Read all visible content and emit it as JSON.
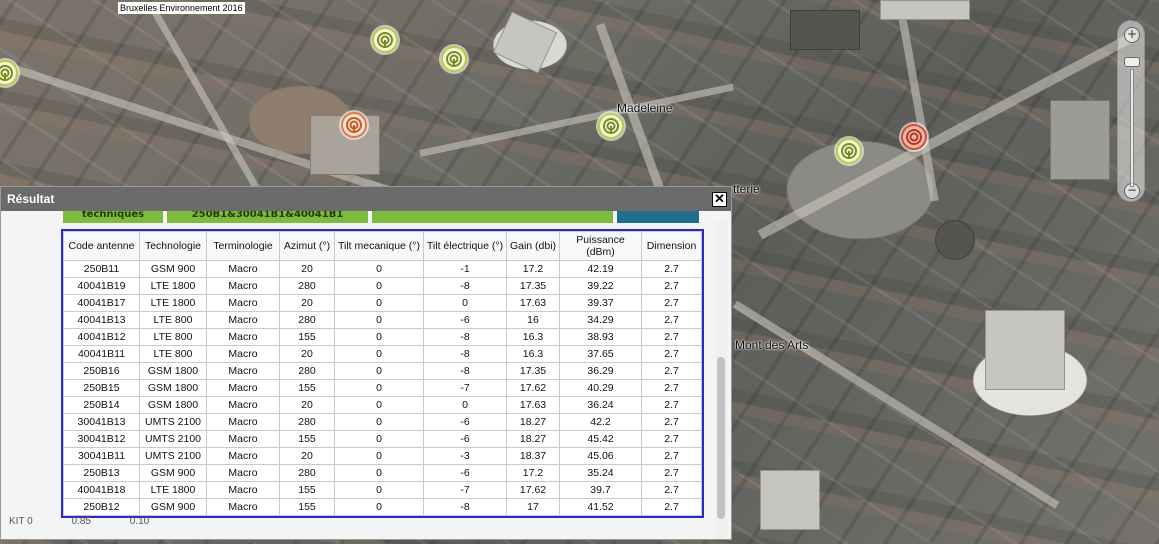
{
  "map": {
    "copyright": "Bruxelles Environnement 2016",
    "labels": {
      "madeleine": "Madeleine",
      "etterie": "tterie",
      "mont_des_arts": "Mont des Arts"
    },
    "zoom": {
      "in_label": "+",
      "out_label": "−"
    }
  },
  "panel": {
    "title": "Résultat",
    "close_label": "✕",
    "tabs": [
      "techniques",
      "250B1&30041B1&40041B1",
      "",
      ""
    ],
    "table": {
      "headers": [
        "Code antenne",
        "Technologie",
        "Terminologie",
        "Azimut (°)",
        "Tilt mecanique (°)",
        "Tilt électrique (°)",
        "Gain (dbi)",
        "Puissance (dBm)",
        "Dimension"
      ],
      "rows": [
        [
          "250B11",
          "GSM 900",
          "Macro",
          "20",
          "0",
          "-1",
          "17.2",
          "42.19",
          "2.7"
        ],
        [
          "40041B19",
          "LTE 1800",
          "Macro",
          "280",
          "0",
          "-8",
          "17.35",
          "39.22",
          "2.7"
        ],
        [
          "40041B17",
          "LTE 1800",
          "Macro",
          "20",
          "0",
          "0",
          "17.63",
          "39.37",
          "2.7"
        ],
        [
          "40041B13",
          "LTE 800",
          "Macro",
          "280",
          "0",
          "-6",
          "16",
          "34.29",
          "2.7"
        ],
        [
          "40041B12",
          "LTE 800",
          "Macro",
          "155",
          "0",
          "-8",
          "16.3",
          "38.93",
          "2.7"
        ],
        [
          "40041B11",
          "LTE 800",
          "Macro",
          "20",
          "0",
          "-8",
          "16.3",
          "37.65",
          "2.7"
        ],
        [
          "250B16",
          "GSM 1800",
          "Macro",
          "280",
          "0",
          "-8",
          "17.35",
          "36.29",
          "2.7"
        ],
        [
          "250B15",
          "GSM 1800",
          "Macro",
          "155",
          "0",
          "-7",
          "17.62",
          "40.29",
          "2.7"
        ],
        [
          "250B14",
          "GSM 1800",
          "Macro",
          "20",
          "0",
          "0",
          "17.63",
          "36.24",
          "2.7"
        ],
        [
          "30041B13",
          "UMTS 2100",
          "Macro",
          "280",
          "0",
          "-6",
          "18.27",
          "42.2",
          "2.7"
        ],
        [
          "30041B12",
          "UMTS 2100",
          "Macro",
          "155",
          "0",
          "-6",
          "18.27",
          "45.42",
          "2.7"
        ],
        [
          "30041B11",
          "UMTS 2100",
          "Macro",
          "20",
          "0",
          "-3",
          "18.37",
          "45.06",
          "2.7"
        ],
        [
          "250B13",
          "GSM 900",
          "Macro",
          "280",
          "0",
          "-6",
          "17.2",
          "35.24",
          "2.7"
        ],
        [
          "40041B18",
          "LTE 1800",
          "Macro",
          "155",
          "0",
          "-7",
          "17.62",
          "39.7",
          "2.7"
        ],
        [
          "250B12",
          "GSM 900",
          "Macro",
          "155",
          "0",
          "-8",
          "17",
          "41.52",
          "2.7"
        ]
      ]
    },
    "hidden_row": [
      "KIT 0",
      "0.85",
      "0.10"
    ]
  },
  "colors": {
    "tab_green": "#7dbb3c",
    "tab_blue": "#1e6f8c",
    "table_border": "#2b2bbf",
    "header_bg": "#6b6b6b"
  }
}
